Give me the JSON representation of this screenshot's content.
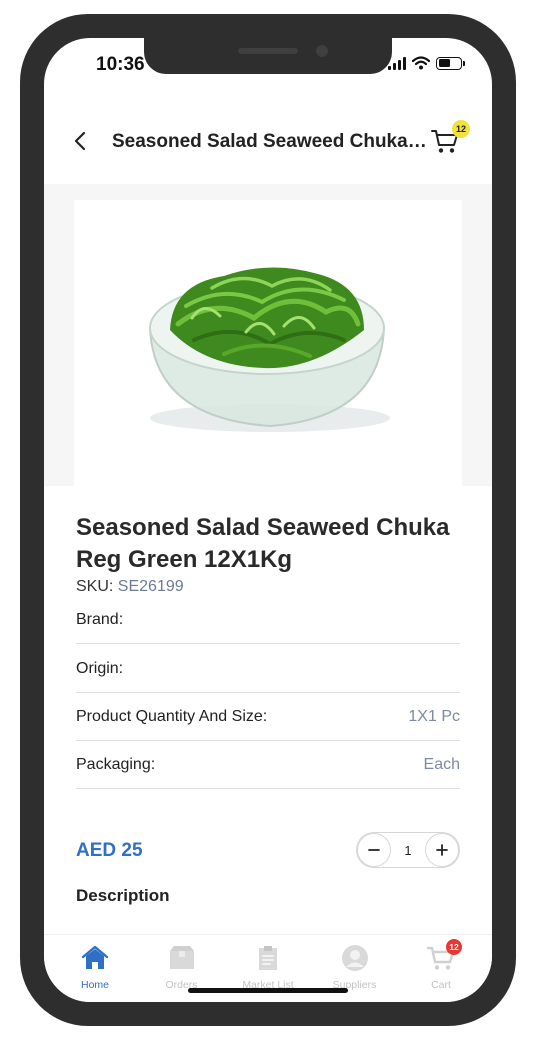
{
  "status_bar": {
    "time": "10:36"
  },
  "header": {
    "title": "Seasoned Salad Seaweed Chuka R...",
    "back_icon": "chevron-left-icon",
    "cart_icon": "cart-icon",
    "cart_count": "12"
  },
  "product": {
    "image_icon": "seaweed-salad-bowl",
    "title": "Seasoned Salad Seaweed Chuka Reg Green 12X1Kg",
    "sku_label": "SKU:",
    "sku_value": "SE26199",
    "specs": [
      {
        "label": "Brand:",
        "value": ""
      },
      {
        "label": "Origin:",
        "value": ""
      },
      {
        "label": "Product Quantity And Size:",
        "value": "1X1 Pc"
      },
      {
        "label": "Packaging:",
        "value": "Each"
      }
    ],
    "price": "AED 25",
    "quantity": "1",
    "description_label": "Description"
  },
  "tabbar": {
    "items": [
      {
        "label": "Home",
        "icon": "home-icon",
        "active": true
      },
      {
        "label": "Orders",
        "icon": "box-icon",
        "active": false
      },
      {
        "label": "Market List",
        "icon": "clipboard-icon",
        "active": false
      },
      {
        "label": "Suppliers",
        "icon": "user-icon",
        "active": false
      },
      {
        "label": "Cart",
        "icon": "cart-icon",
        "active": false,
        "badge": "12"
      }
    ]
  },
  "colors": {
    "accent": "#2f6fc6",
    "badge_yellow": "#f5e13c",
    "badge_red": "#e53935",
    "inactive_tab": "#c3c3c3"
  }
}
